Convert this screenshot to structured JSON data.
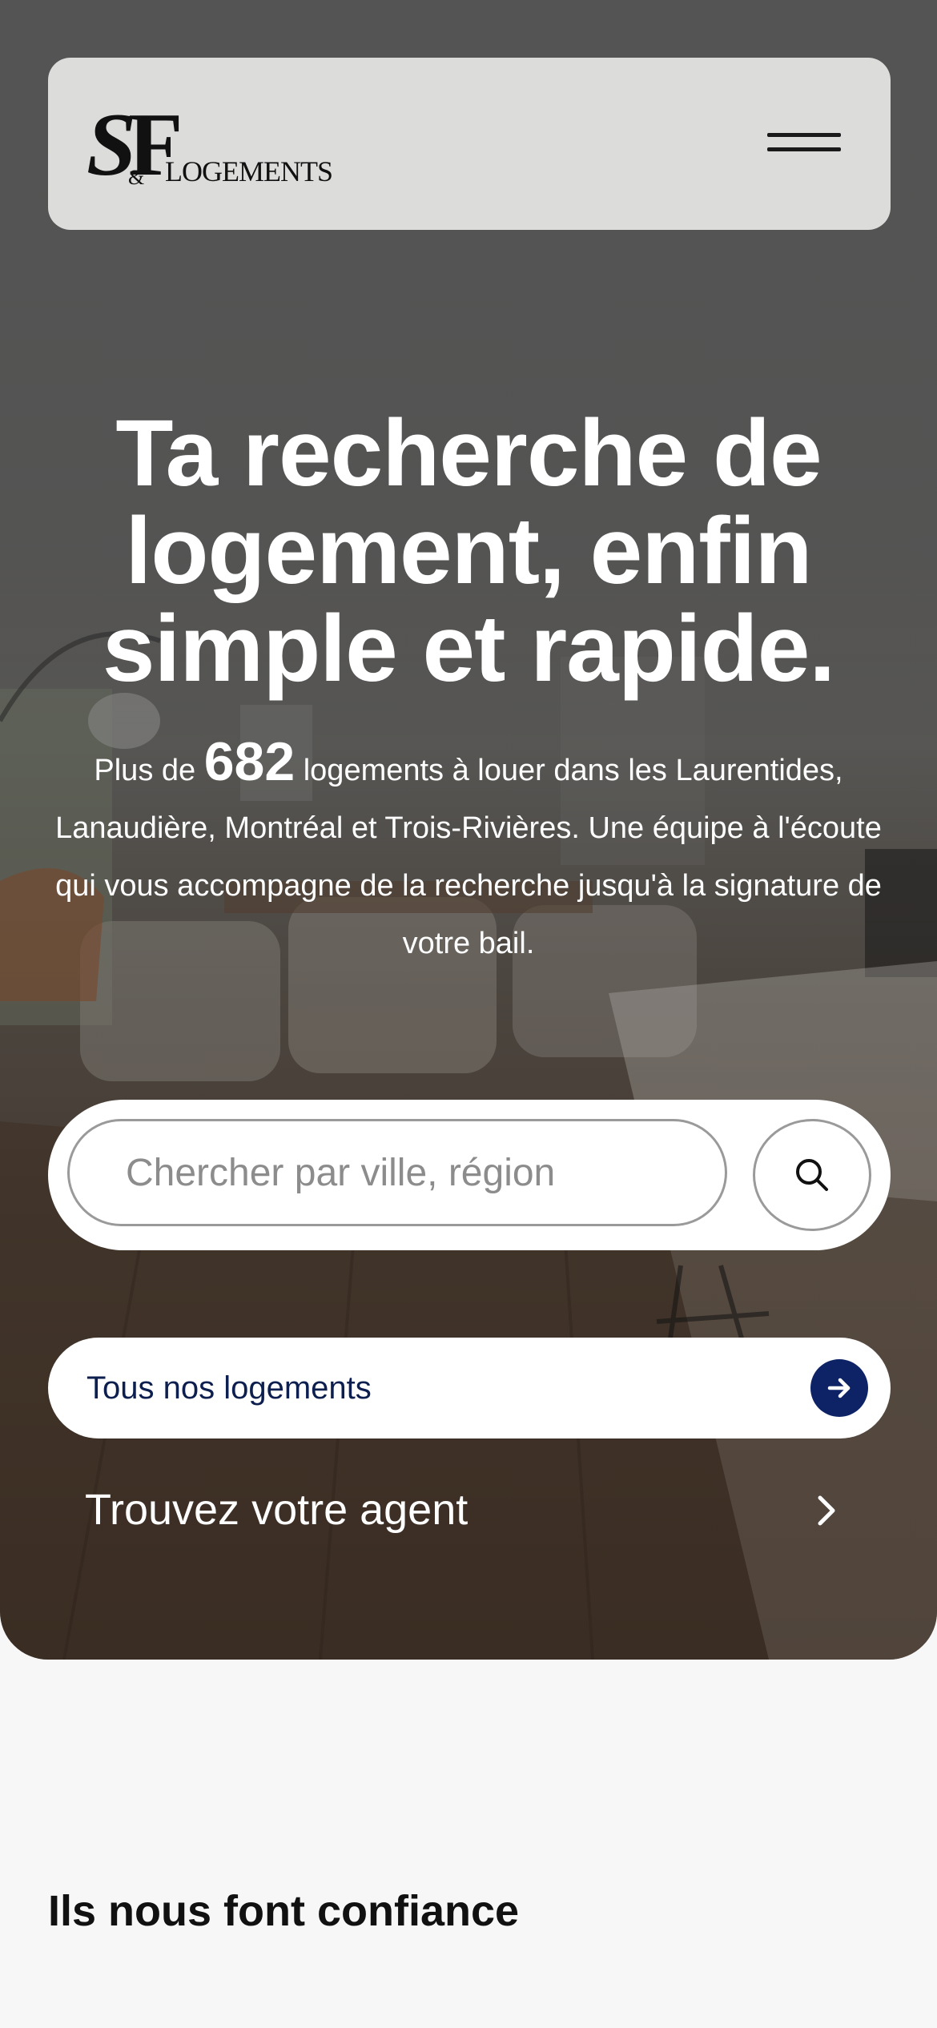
{
  "header": {
    "logo_text": "S&F LOGEMENTS",
    "menu_icon": "hamburger-icon"
  },
  "hero": {
    "headline": "Ta recherche de logement, enfin simple et rapide.",
    "sub_prefix": "Plus de",
    "listing_count": "682",
    "sub_suffix": "logements à louer dans les Laurentides, Lanaudière, Montréal et Trois-Rivières. Une équipe à l'écoute qui vous accompagne de la recherche jusqu'à la signature de votre bail."
  },
  "search": {
    "placeholder": "Chercher par ville, région",
    "value": "",
    "button_icon": "search-icon"
  },
  "actions": {
    "all_listings_label": "Tous nos logements",
    "all_listings_icon": "arrow-right-icon",
    "agent_label": "Trouvez votre agent",
    "agent_icon": "chevron-right-icon"
  },
  "sections": {
    "trust_title": "Ils nous font confiance"
  },
  "colors": {
    "navy": "#0d2366",
    "header_bg": "#dcdcdb",
    "page_bg": "#f7f7f7"
  }
}
